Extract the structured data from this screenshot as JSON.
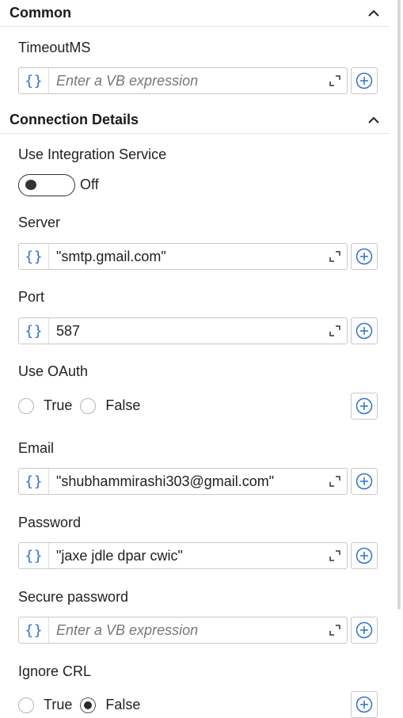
{
  "sections": {
    "common": {
      "title": "Common"
    },
    "connection": {
      "title": "Connection Details"
    }
  },
  "fields": {
    "timeout": {
      "label": "TimeoutMS",
      "value": "Enter a VB expression"
    },
    "integration": {
      "label": "Use Integration Service",
      "toggle_state": "Off"
    },
    "server": {
      "label": "Server",
      "value": "\"smtp.gmail.com\""
    },
    "port": {
      "label": "Port",
      "value": "587"
    },
    "oauth": {
      "label": "Use OAuth",
      "true_label": "True",
      "false_label": "False"
    },
    "email": {
      "label": "Email",
      "value": "\"shubhammirashi303@gmail.com\""
    },
    "password": {
      "label": "Password",
      "value": "\"jaxe jdle dpar cwic\""
    },
    "secure_password": {
      "label": "Secure password",
      "value": "Enter a VB expression"
    },
    "ignore_crl": {
      "label": "Ignore CRL",
      "true_label": "True",
      "false_label": "False",
      "selected": "False"
    }
  },
  "icons": {
    "braces": "{}",
    "collapse": "chevron-up-icon",
    "expand": "expand-editor-icon",
    "add": "plus-circle-icon"
  },
  "colors": {
    "accent": "#2f6fd6"
  }
}
